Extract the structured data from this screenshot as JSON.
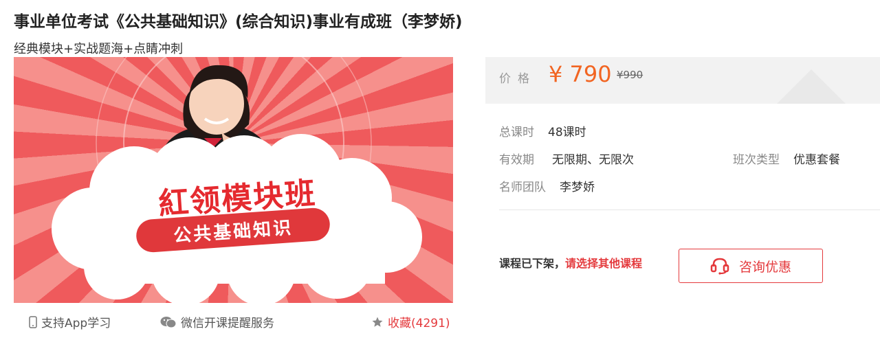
{
  "course": {
    "title": "事业单位考试《公共基础知识》(综合知识)事业有成班（李梦娇)",
    "subtitle": "经典模块+实战题海+点睛冲刺"
  },
  "banner": {
    "main_text": "紅领模块班",
    "pill_text": "公共基础知识"
  },
  "banner_footer": {
    "app_label": "支持App学习",
    "wechat_label": "微信开课提醒服务",
    "favorite_label": "收藏(4291)"
  },
  "price": {
    "label": "价格",
    "current": "¥ 790",
    "original": "¥990"
  },
  "info": {
    "hours_label": "总课时",
    "hours_value": "48课时",
    "validity_label": "有效期",
    "validity_value": "无限期、无限次",
    "class_type_label": "班次类型",
    "class_type_value": "优惠套餐",
    "teacher_label": "名师团队",
    "teacher_value": "李梦娇"
  },
  "status": {
    "offline_text": "课程已下架，",
    "offline_hint": "请选择其他课程",
    "consult_label": "咨询优惠"
  },
  "colors": {
    "accent": "#e4393c",
    "price": "#f26522"
  }
}
